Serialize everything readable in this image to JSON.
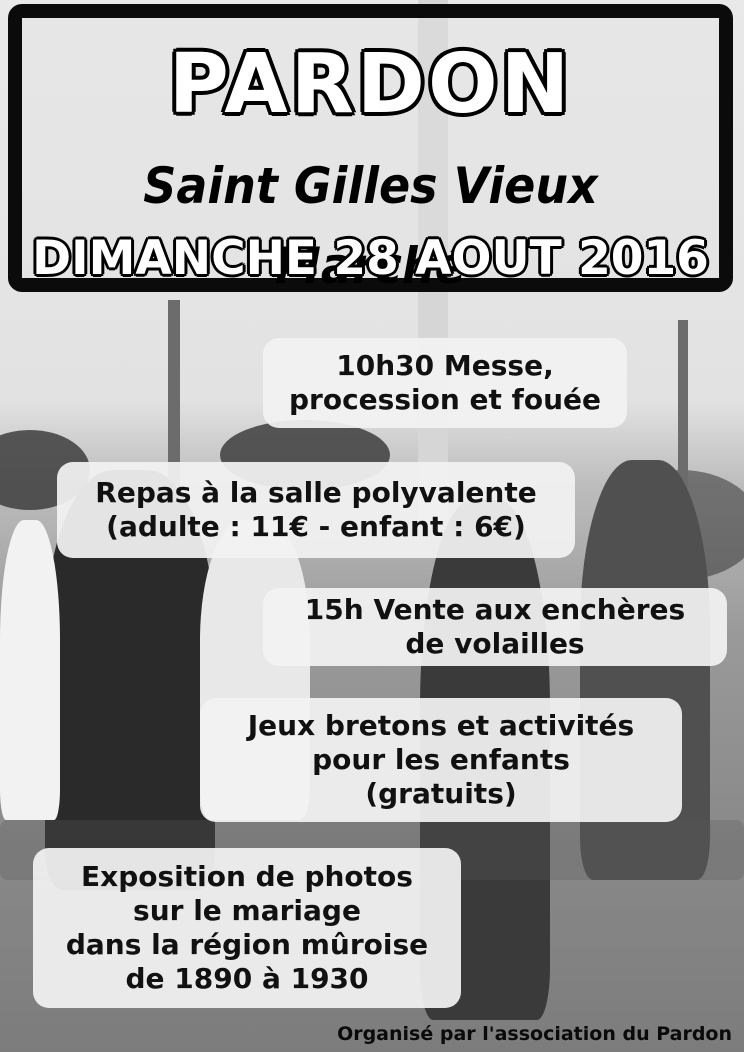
{
  "header": {
    "title": "PARDON",
    "place": "Saint Gilles Vieux Marché",
    "date": "DIMANCHE 28 AOUT 2016"
  },
  "program": [
    {
      "lines": [
        "10h30 Messe,",
        "procession et fouée"
      ]
    },
    {
      "lines": [
        "Repas à la salle polyvalente",
        "(adulte : 11€ - enfant : 6€)"
      ]
    },
    {
      "lines": [
        "15h Vente aux enchères",
        "de volailles"
      ]
    },
    {
      "lines": [
        "Jeux bretons et activités",
        "pour les enfants",
        "(gratuits)"
      ]
    },
    {
      "lines": [
        "Exposition de photos",
        "sur le mariage",
        "dans la région mûroise",
        "de 1890 à 1930"
      ]
    }
  ],
  "footer": "Organisé par l'association du Pardon"
}
